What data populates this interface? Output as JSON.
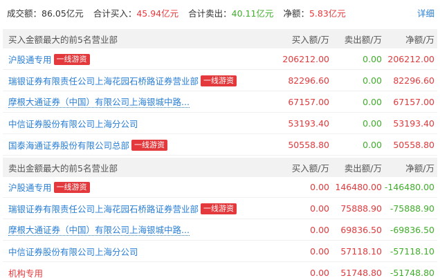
{
  "summary": {
    "turnover_label": "成交额：",
    "turnover_value": "86.05亿元",
    "buy_label": "合计买入：",
    "buy_value": "45.94亿元",
    "sell_label": "合计卖出：",
    "sell_value": "40.11亿元",
    "net_label": "净额：",
    "net_value": "5.83亿元",
    "detail_link": "详细"
  },
  "buy_section": {
    "title": "买入金额最大的前5名营业部",
    "col_buy": "买入额/万",
    "col_sell": "卖出额/万",
    "col_net": "净额/万",
    "rows": [
      {
        "name": "沪股通专用",
        "badge": "一线游资",
        "buy": "206212.00",
        "sell": "0.00",
        "net": "206212.00"
      },
      {
        "name": "瑞银证券有限责任公司上海花园石桥路证券营业部",
        "badge": "一线游资",
        "buy": "82296.60",
        "sell": "0.00",
        "net": "82296.60"
      },
      {
        "name": "摩根大通证券（中国）有限公司上海银城中路...",
        "badge": "",
        "buy": "67157.00",
        "sell": "0.00",
        "net": "67157.00"
      },
      {
        "name": "中信证券股份有限公司上海分公司",
        "badge": "",
        "buy": "53193.40",
        "sell": "0.00",
        "net": "53193.40"
      },
      {
        "name": "国泰海通证券股份有限公司总部",
        "badge": "一线游资",
        "buy": "50558.80",
        "sell": "0.00",
        "net": "50558.80"
      }
    ]
  },
  "sell_section": {
    "title": "卖出金额最大的前5名营业部",
    "col_buy": "买入额/万",
    "col_sell": "卖出额/万",
    "col_net": "净额/万",
    "rows": [
      {
        "name": "沪股通专用",
        "badge": "一线游资",
        "buy": "0.00",
        "sell": "146480.00",
        "net": "-146480.00"
      },
      {
        "name": "瑞银证券有限责任公司上海花园石桥路证券营业部",
        "badge": "一线游资",
        "buy": "0.00",
        "sell": "75888.90",
        "net": "-75888.90"
      },
      {
        "name": "摩根大通证券（中国）有限公司上海银城中路...",
        "badge": "",
        "buy": "0.00",
        "sell": "69836.50",
        "net": "-69836.50"
      },
      {
        "name": "中信证券股份有限公司上海分公司",
        "badge": "",
        "buy": "0.00",
        "sell": "57118.10",
        "net": "-57118.10"
      },
      {
        "name": "机构专用",
        "badge": "",
        "buy": "0.00",
        "sell": "51748.80",
        "net": "-51748.80"
      }
    ]
  },
  "colors": {
    "positive": "#e4393c",
    "negative": "#3fae2a",
    "link": "#2a7fd4",
    "header_bg": "#f2f2f2"
  }
}
